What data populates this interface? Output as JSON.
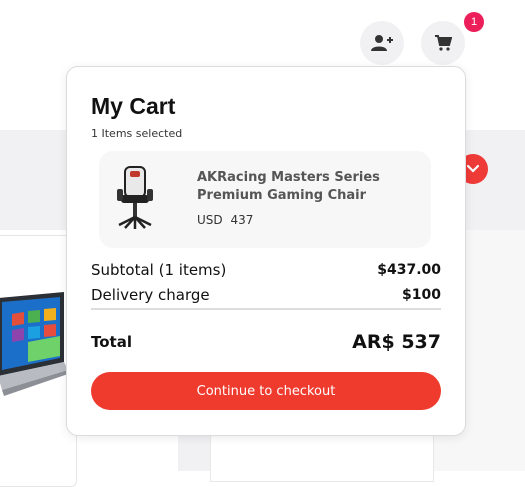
{
  "header": {
    "user_icon": "add-user-icon",
    "cart_icon": "cart-icon",
    "cart_count": "1"
  },
  "cart": {
    "title": "My Cart",
    "subtitle": "1 Items selected",
    "item": {
      "name": "AKRacing Masters Series Premium Gaming Chair",
      "currency": "USD",
      "price": "437"
    },
    "subtotal_label": "Subtotal (1 items)",
    "subtotal_value": "$437.00",
    "delivery_label": "Delivery charge",
    "delivery_value": "$100",
    "total_label": "Total",
    "total_value": "AR$ 537",
    "checkout_label": "Continue to checkout"
  },
  "colors": {
    "accent": "#ee3b2e",
    "badge": "#ec1f5a"
  }
}
